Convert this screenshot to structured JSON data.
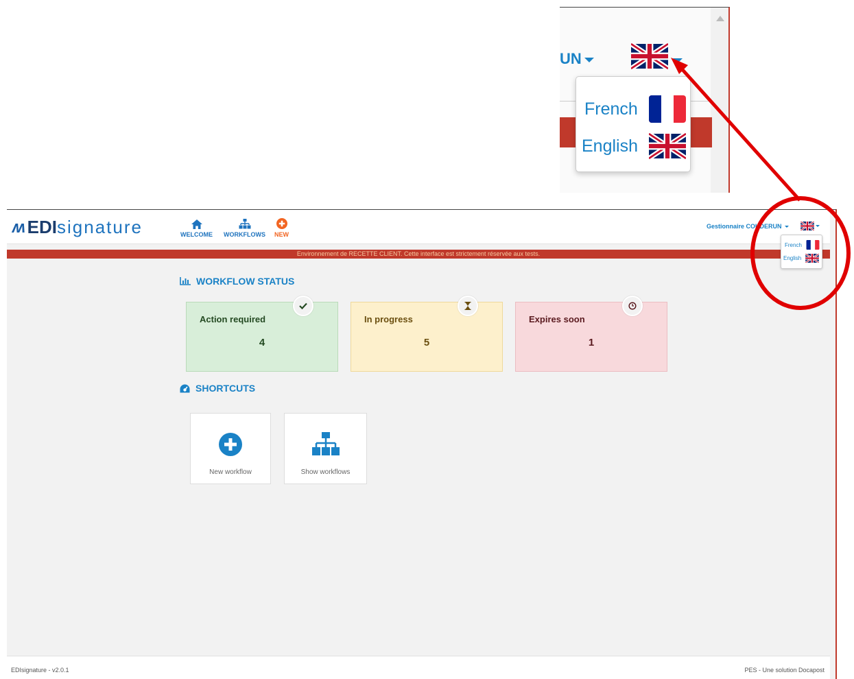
{
  "zoom": {
    "user_fragment": "UN",
    "languages": [
      {
        "label": "French",
        "flag": "fr-flag-icon"
      },
      {
        "label": "English",
        "flag": "uk-flag-icon"
      }
    ]
  },
  "header": {
    "logo_mark": "ʍ",
    "logo_edi": "EDI",
    "logo_signature": "signature",
    "nav": [
      {
        "label": "WELCOME",
        "icon": "home-icon"
      },
      {
        "label": "WORKFLOWS",
        "icon": "sitemap-icon"
      },
      {
        "label": "NEW",
        "icon": "plus-circle-icon"
      }
    ],
    "user": "Gestionnaire COUDERUN",
    "language_menu": [
      {
        "label": "French",
        "flag": "fr-flag-icon"
      },
      {
        "label": "English",
        "flag": "uk-flag-icon"
      }
    ]
  },
  "banner": "Environnement de RECETTE CLIENT. Cette interface est strictement réservée aux tests.",
  "workflow_status": {
    "title": "WORKFLOW STATUS",
    "cards": [
      {
        "label": "Action required",
        "value": "4",
        "icon": "check-icon",
        "color": "#d8eed9"
      },
      {
        "label": "In progress",
        "value": "5",
        "icon": "hourglass-icon",
        "color": "#fdf0cc"
      },
      {
        "label": "Expires soon",
        "value": "1",
        "icon": "clock-icon",
        "color": "#f8d9dc"
      }
    ]
  },
  "shortcuts": {
    "title": "SHORTCUTS",
    "items": [
      {
        "label": "New workflow",
        "icon": "plus-circle-icon"
      },
      {
        "label": "Show workflows",
        "icon": "sitemap-icon"
      }
    ]
  },
  "footer": {
    "left": "EDIsignature - v2.0.1",
    "right": "PES - Une solution Docapost"
  },
  "colors": {
    "accent": "#1a82c6",
    "new_orange": "#f26522",
    "banner_red": "#c0392b",
    "highlight_red": "#e00000"
  }
}
